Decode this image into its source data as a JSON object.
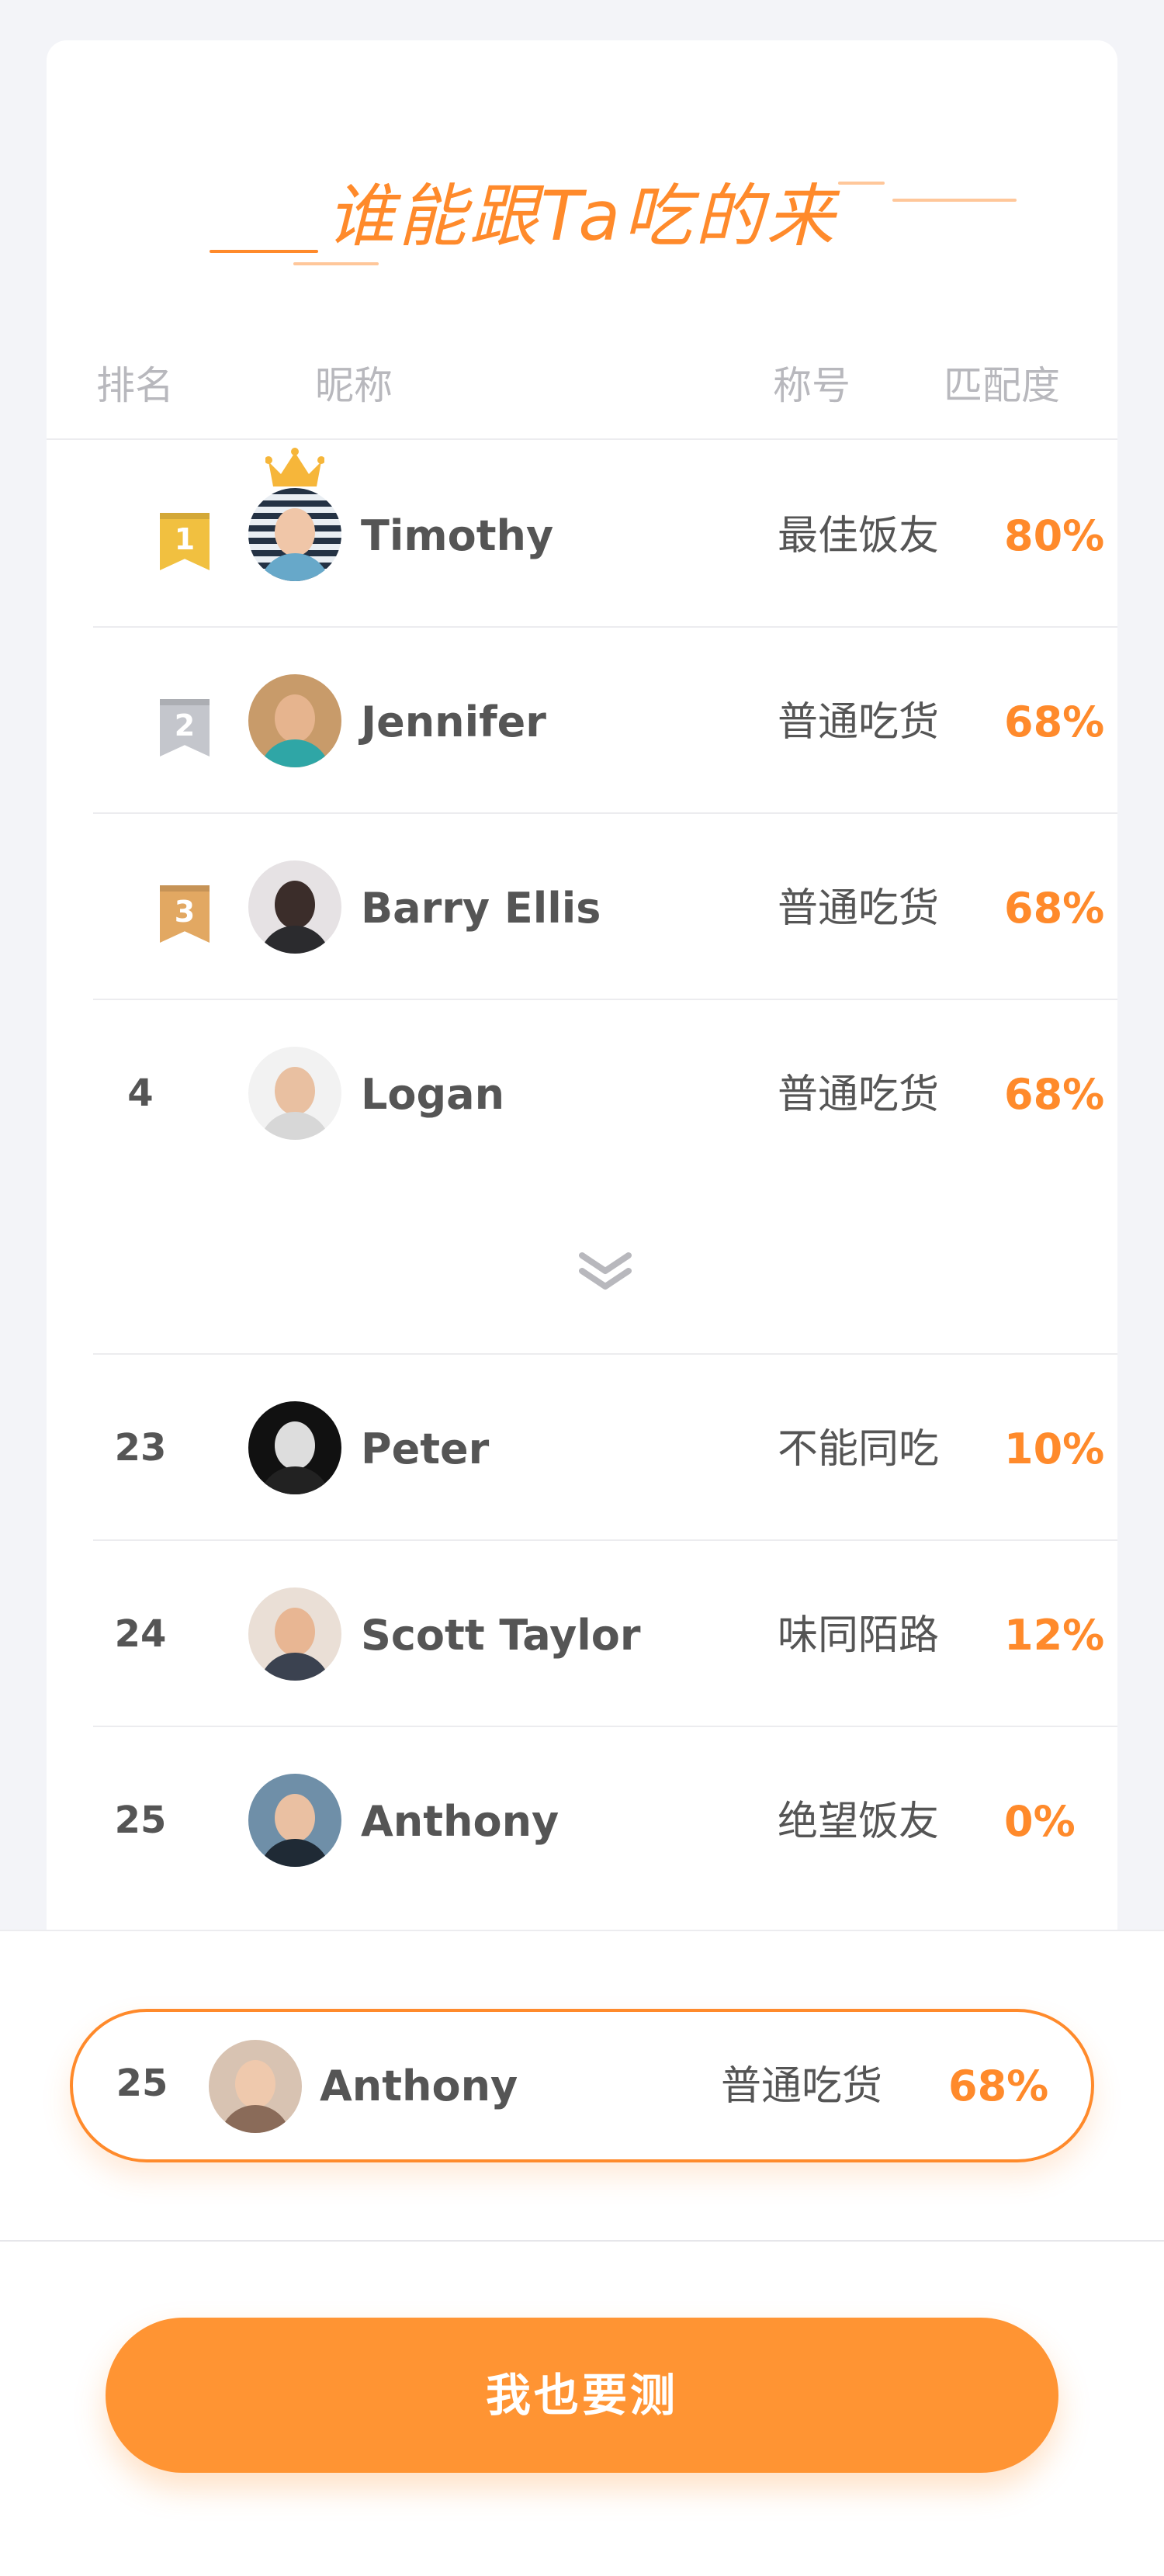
{
  "title": "谁能跟Ta吃的来",
  "headers": {
    "rank": "排名",
    "nickname": "昵称",
    "title": "称号",
    "match": "匹配度"
  },
  "rows": [
    {
      "rank": "1",
      "name": "Timothy",
      "title": "最佳饭友",
      "match": "80%",
      "medal": "gold",
      "crown": true
    },
    {
      "rank": "2",
      "name": "Jennifer",
      "title": "普通吃货",
      "match": "68%",
      "medal": "silver"
    },
    {
      "rank": "3",
      "name": "Barry Ellis",
      "title": "普通吃货",
      "match": "68%",
      "medal": "bronze"
    },
    {
      "rank": "4",
      "name": "Logan",
      "title": "普通吃货",
      "match": "68%"
    },
    {
      "rank": "23",
      "name": "Peter",
      "title": "不能同吃",
      "match": "10%"
    },
    {
      "rank": "24",
      "name": "Scott Taylor",
      "title": "味同陌路",
      "match": "12%"
    },
    {
      "rank": "25",
      "name": "Anthony",
      "title": "绝望饭友",
      "match": "0%"
    }
  ],
  "my_rank": {
    "rank": "25",
    "name": "Anthony",
    "title": "普通吃货",
    "match": "68%"
  },
  "cta_label": "我也要测",
  "colors": {
    "accent": "#ff8a2b",
    "button": "#ff9433",
    "gold": "#f1c040",
    "silver": "#c4c6cc",
    "bronze": "#e2a862"
  },
  "icons": {
    "crown": "crown-icon",
    "expand": "chevron-double-down-icon"
  }
}
